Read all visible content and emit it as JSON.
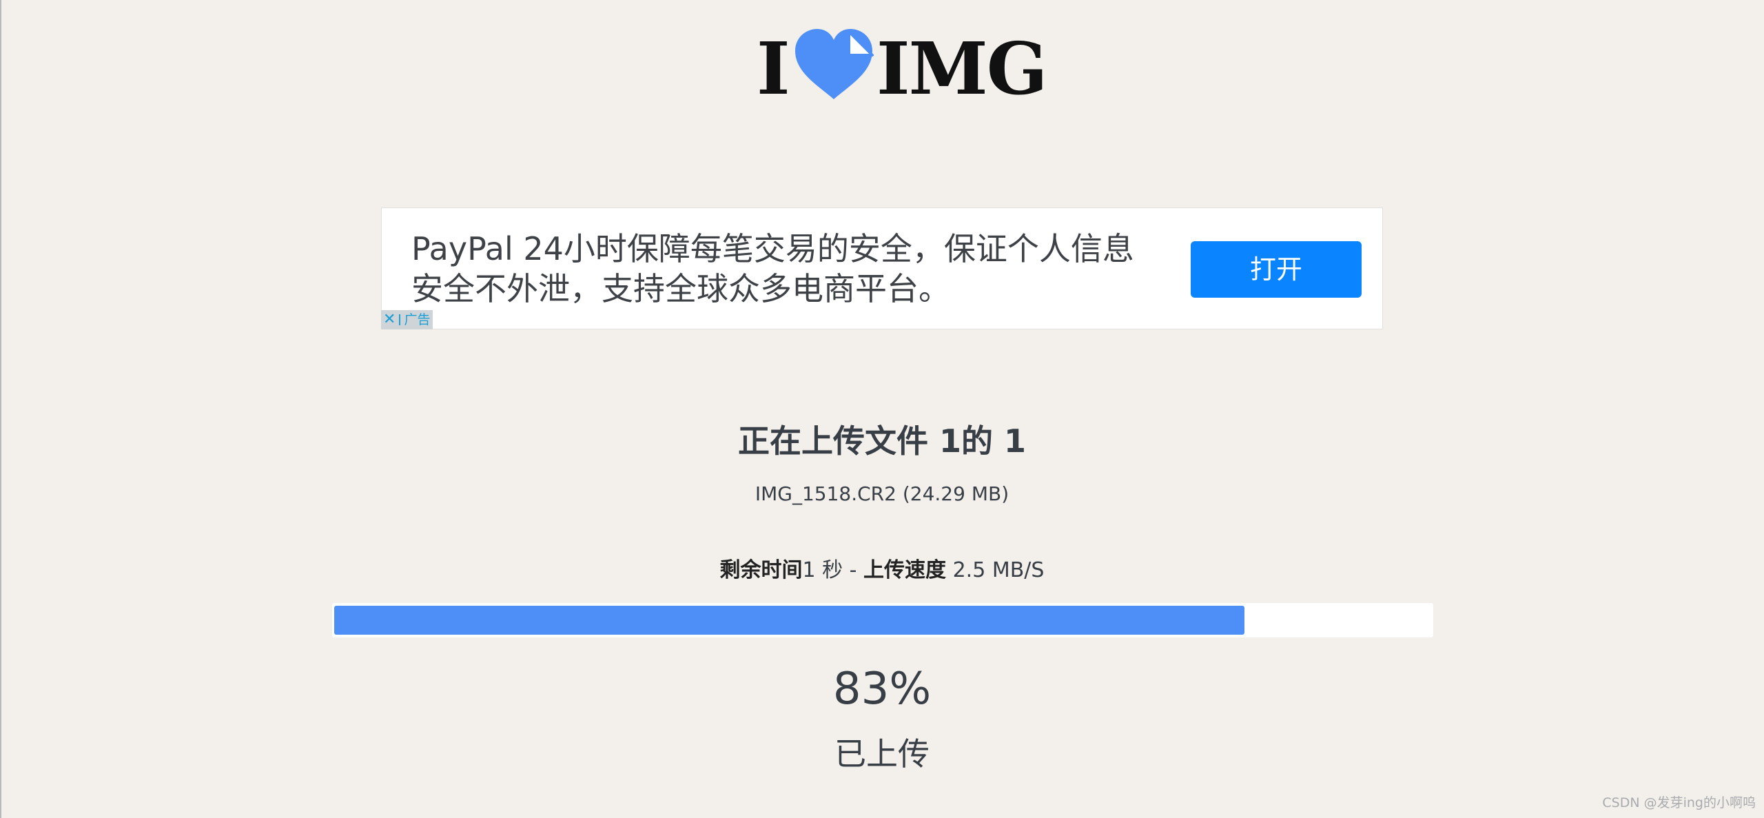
{
  "logo": {
    "left_text": "I",
    "right_text": "IMG",
    "heart_color": "#4d8ff6"
  },
  "ad": {
    "text": "PayPal 24小时保障每笔交易的安全，保证个人信息安全不外泄，支持全球众多电商平台。",
    "button_label": "打开",
    "badge_label": "广告",
    "close_icon": "close-icon"
  },
  "upload": {
    "title": "正在上传文件 1的 1",
    "file_info": "IMG_1518.CR2 (24.29 MB)",
    "remaining_label": "剩余时间",
    "remaining_value": "1 秒",
    "separator": " - ",
    "speed_label": "上传速度",
    "speed_value": "2.5 MB/S",
    "progress_percent": 83,
    "percent_text": "83%",
    "status_label": "已上传"
  },
  "watermark": "CSDN @发芽ing的小啊呜",
  "colors": {
    "background": "#f3f0eb",
    "accent": "#4d8ff6",
    "ad_button": "#0a84ff"
  }
}
